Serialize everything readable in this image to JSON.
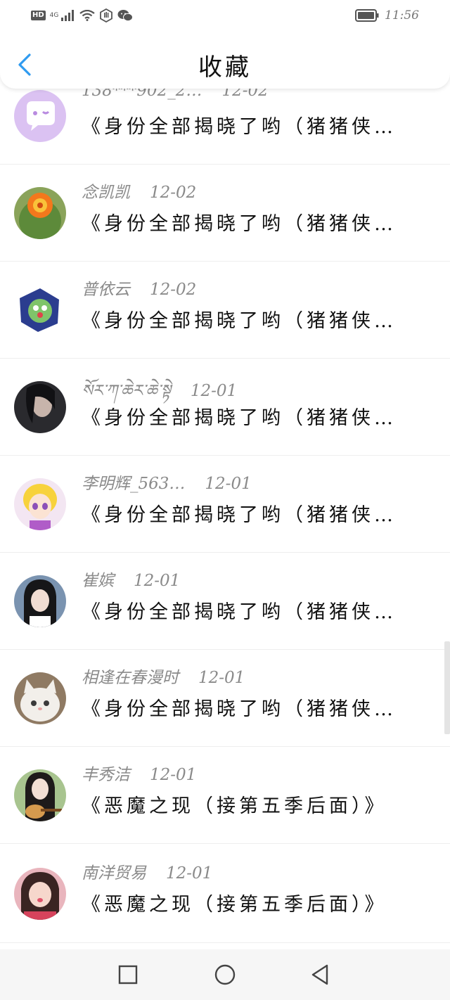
{
  "status_bar": {
    "hd": "HD",
    "network": "4G",
    "time": "11:56",
    "icons": [
      "signal-icon",
      "wifi-icon",
      "hand-icon",
      "wechat-icon",
      "battery-icon"
    ]
  },
  "header": {
    "title": "收藏",
    "back_icon": "back-chevron-icon",
    "accent_color": "#2f9bf0"
  },
  "favorites": [
    {
      "author": "138***902_2…",
      "date": "12-02",
      "title": "《身份全部揭晓了哟（猪猪侠…",
      "avatar": "purple-chat-bubble"
    },
    {
      "author": "念凯凯",
      "date": "12-02",
      "title": "《身份全部揭晓了哟（猪猪侠…",
      "avatar": "cactus-flower"
    },
    {
      "author": "普依云",
      "date": "12-02",
      "title": "《身份全部揭晓了哟（猪猪侠…",
      "avatar": "cartoon-sticker"
    },
    {
      "author": "སོར་ཀ་ཆེར་ཆེ་སྟེ",
      "date": "12-01",
      "title": "《身份全部揭晓了哟（猪猪侠…",
      "avatar": "dark-hair-girl"
    },
    {
      "author": "李明辉_563…",
      "date": "12-01",
      "title": "《身份全部揭晓了哟（猪猪侠…",
      "avatar": "anime-blonde-girl"
    },
    {
      "author": "崔嫔",
      "date": "12-01",
      "title": "《身份全部揭晓了哟（猪猪侠…",
      "avatar": "girl-portrait"
    },
    {
      "author": "相逢在春漫时",
      "date": "12-01",
      "title": "《身份全部揭晓了哟（猪猪侠…",
      "avatar": "white-kitten"
    },
    {
      "author": "丰秀洁",
      "date": "12-01",
      "title": "《恶魔之现（接第五季后面）》",
      "avatar": "girl-with-guitar"
    },
    {
      "author": "南洋贸易",
      "date": "12-01",
      "title": "《恶魔之现（接第五季后面）》",
      "avatar": "girl-selfie"
    }
  ],
  "nav_bar": {
    "icons": [
      "recents-square-icon",
      "home-circle-icon",
      "back-triangle-icon"
    ]
  }
}
